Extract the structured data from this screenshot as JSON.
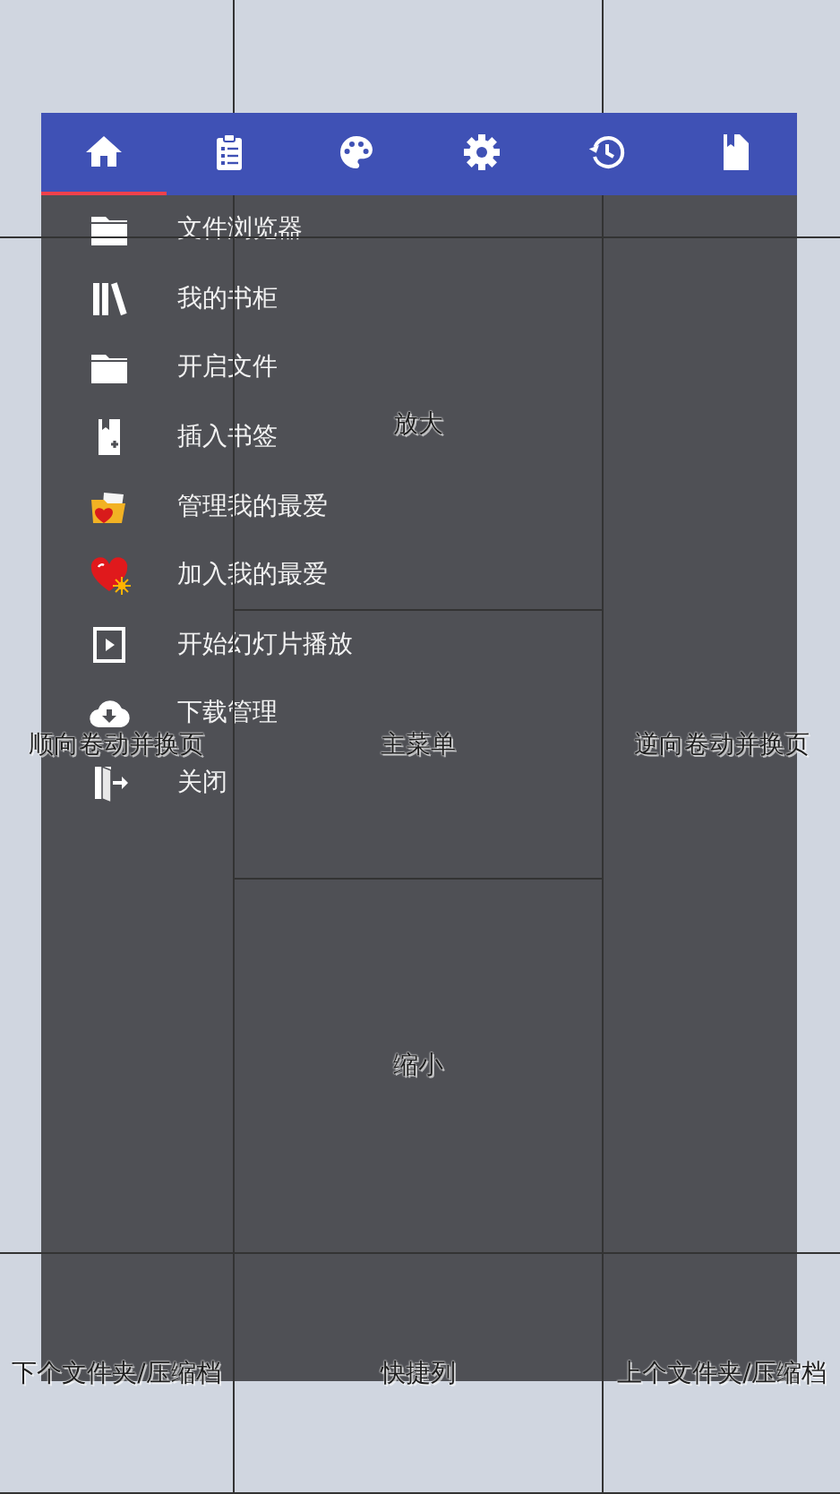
{
  "tabs": [
    {
      "selected": true
    },
    {
      "selected": false
    },
    {
      "selected": false
    },
    {
      "selected": false
    },
    {
      "selected": false
    },
    {
      "selected": false
    }
  ],
  "menu": {
    "items": [
      {
        "label": "文件浏览器"
      },
      {
        "label": "我的书柜"
      },
      {
        "label": "开启文件"
      },
      {
        "label": "插入书签"
      },
      {
        "label": "管理我的最爱"
      },
      {
        "label": "加入我的最爱"
      },
      {
        "label": "开始幻灯片播放"
      },
      {
        "label": "下载管理"
      },
      {
        "label": "关闭"
      }
    ]
  },
  "zones": [
    {
      "label": "放大"
    },
    {
      "label": "顺向卷动并换页"
    },
    {
      "label": "主菜单"
    },
    {
      "label": "逆向卷动并换页"
    },
    {
      "label": "缩小"
    },
    {
      "label": "下个文件夹/压缩档"
    },
    {
      "label": "快捷列"
    },
    {
      "label": "上个文件夹/压缩档"
    }
  ]
}
